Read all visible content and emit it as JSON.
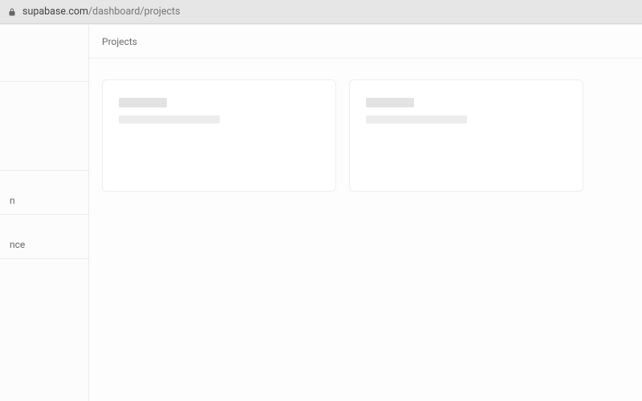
{
  "address_bar": {
    "host": "supabase.com",
    "path": "/dashboard/projects",
    "lock_icon": "lock-icon"
  },
  "sidebar": {
    "items": [
      {
        "label": ""
      },
      {
        "label": ""
      },
      {
        "label": "n"
      },
      {
        "label": "nce"
      },
      {
        "label": ""
      }
    ]
  },
  "topbar": {
    "breadcrumb": "Projects"
  },
  "cards": [
    {
      "placeholder": true
    },
    {
      "placeholder": true
    }
  ]
}
